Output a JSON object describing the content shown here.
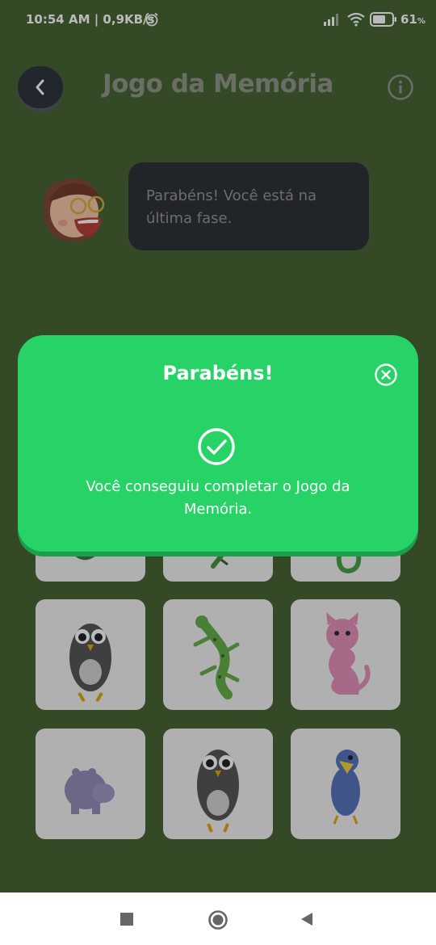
{
  "status_bar": {
    "time_speed": "10:54 AM | 0,9KB/s",
    "battery": "61",
    "battery_unit": "%"
  },
  "header": {
    "title": "Jogo da Memória"
  },
  "speech": {
    "text": "Parabéns! Você está na última fase."
  },
  "cards": [
    {
      "animal": "snake-icon"
    },
    {
      "animal": "lizard-icon"
    },
    {
      "animal": "snake-icon"
    },
    {
      "animal": "owl-icon"
    },
    {
      "animal": "lizard-icon"
    },
    {
      "animal": "cat-icon"
    },
    {
      "animal": "hippo-icon"
    },
    {
      "animal": "owl-icon"
    },
    {
      "animal": "bird-icon"
    }
  ],
  "modal": {
    "title": "Parabéns!",
    "message": "Você conseguiu completar o Jogo da Memória."
  },
  "colors": {
    "background": "#3a5a27",
    "modal": "#27d366",
    "bubble": "#1e242c"
  }
}
